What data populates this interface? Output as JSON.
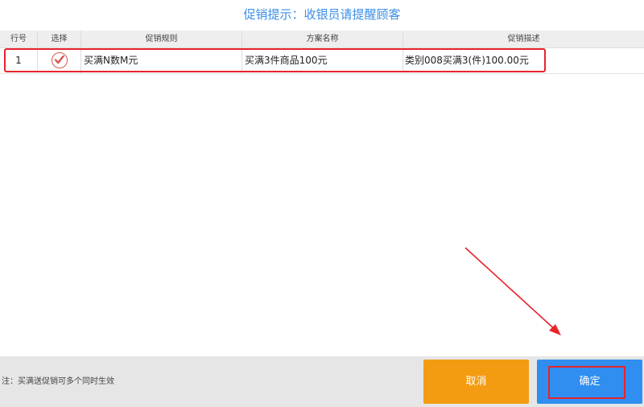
{
  "title": "促销提示：收银员请提醒顾客",
  "table": {
    "headers": {
      "row_no": "行号",
      "select": "选择",
      "rule": "促销规则",
      "plan_name": "方案名称",
      "description": "促销描述"
    },
    "rows": [
      {
        "row_no": "1",
        "selected": true,
        "rule": "买满N数M元",
        "plan_name": "买满3件商品100元",
        "description": "类别008买满3(件)100.00元"
      }
    ]
  },
  "footer": {
    "note": "注：买满送促销可多个同时生效",
    "cancel_label": "取消",
    "ok_label": "确定"
  },
  "colors": {
    "title": "#3a8ee6",
    "cancel": "#f39c12",
    "ok": "#2f8ef0",
    "annotation": "#e8232c"
  },
  "icons": {
    "selected": "check-circle-icon"
  }
}
